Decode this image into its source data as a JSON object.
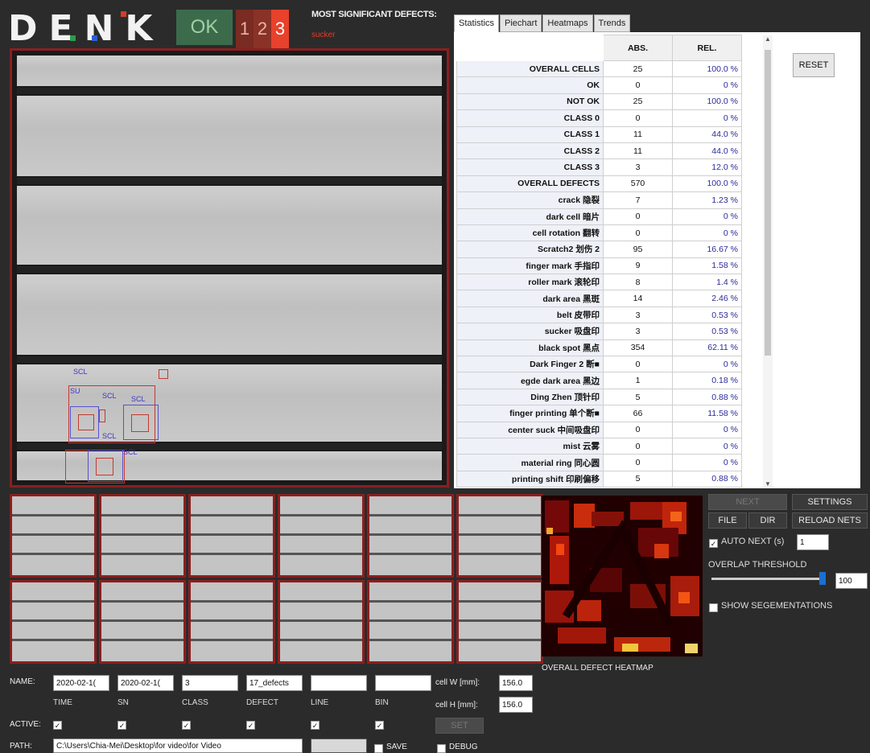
{
  "header": {
    "logo": "DENK",
    "ok_label": "OK",
    "class_buttons": [
      "1",
      "2",
      "3"
    ],
    "msd_title": "MOST SIGNIFICANT DEFECTS:",
    "msd_value": "sucker"
  },
  "main_image": {
    "labels": [
      "SCL",
      "SCL",
      "SU",
      "SCL",
      "SCL",
      "SCL",
      "SCL"
    ]
  },
  "tabs": [
    "Statistics",
    "Piechart",
    "Heatmaps",
    "Trends"
  ],
  "stats": {
    "col_abs": "ABS.",
    "col_rel": "REL.",
    "rows": [
      {
        "label": "OVERALL CELLS",
        "abs": "25",
        "rel": "100.0 %"
      },
      {
        "label": "OK",
        "abs": "0",
        "rel": "0 %"
      },
      {
        "label": "NOT OK",
        "abs": "25",
        "rel": "100.0 %"
      },
      {
        "label": "CLASS 0",
        "abs": "0",
        "rel": "0 %"
      },
      {
        "label": "CLASS 1",
        "abs": "11",
        "rel": "44.0 %"
      },
      {
        "label": "CLASS 2",
        "abs": "11",
        "rel": "44.0 %"
      },
      {
        "label": "CLASS 3",
        "abs": "3",
        "rel": "12.0 %"
      },
      {
        "label": "OVERALL DEFECTS",
        "abs": "570",
        "rel": "100.0 %"
      },
      {
        "label": "crack 隐裂",
        "abs": "7",
        "rel": "1.23 %"
      },
      {
        "label": "dark cell 暗片",
        "abs": "0",
        "rel": "0 %"
      },
      {
        "label": "cell rotation 翻转",
        "abs": "0",
        "rel": "0 %"
      },
      {
        "label": "Scratch2 划伤 2",
        "abs": "95",
        "rel": "16.67 %"
      },
      {
        "label": "finger mark 手指印",
        "abs": "9",
        "rel": "1.58 %"
      },
      {
        "label": "roller mark 滚轮印",
        "abs": "8",
        "rel": "1.4 %"
      },
      {
        "label": "dark area 黑斑",
        "abs": "14",
        "rel": "2.46 %"
      },
      {
        "label": "belt 皮带印",
        "abs": "3",
        "rel": "0.53 %"
      },
      {
        "label": "sucker 吸盘印",
        "abs": "3",
        "rel": "0.53 %"
      },
      {
        "label": "black spot 黑点",
        "abs": "354",
        "rel": "62.11 %"
      },
      {
        "label": "Dark Finger 2 断■",
        "abs": "0",
        "rel": "0 %"
      },
      {
        "label": "egde dark area 黑边",
        "abs": "1",
        "rel": "0.18 %"
      },
      {
        "label": "Ding Zhen 顶针印",
        "abs": "5",
        "rel": "0.88 %"
      },
      {
        "label": "finger printing 单个断■",
        "abs": "66",
        "rel": "11.58 %"
      },
      {
        "label": "center suck 中间吸盘印",
        "abs": "0",
        "rel": "0 %"
      },
      {
        "label": "mist 云雾",
        "abs": "0",
        "rel": "0 %"
      },
      {
        "label": "material ring 同心圆",
        "abs": "0",
        "rel": "0 %"
      },
      {
        "label": "printing shift 印刷偏移",
        "abs": "5",
        "rel": "0.88 %"
      }
    ]
  },
  "reset_label": "RESET",
  "controls": {
    "next": "NEXT",
    "settings": "SETTINGS",
    "file": "FILE",
    "dir": "DIR",
    "reload_nets": "RELOAD NETS",
    "auto_next_label": "AUTO NEXT (s)",
    "auto_next_value": "1",
    "overlap_label": "OVERLAP THRESHOLD",
    "overlap_value": "100",
    "overlap_level": 1.0,
    "show_seg_label": "SHOW SEGEMENTATIONS"
  },
  "heatmap_caption": "OVERALL DEFECT HEATMAP",
  "form": {
    "name_label": "NAME:",
    "fields": [
      "2020-02-1(",
      "2020-02-1(",
      "3",
      "17_defects",
      "",
      ""
    ],
    "columns": [
      "TIME",
      "SN",
      "CLASS",
      "DEFECT",
      "LINE",
      "BIN"
    ],
    "active_label": "ACTIVE:",
    "path_label": "PATH:",
    "path_value": "C:\\Users\\Chia-Mei\\Desktop\\for video\\for Video",
    "cell_w_label": "cell W [mm]:",
    "cell_w_value": "156.0",
    "cell_h_label": "cell H [mm]:",
    "cell_h_value": "156.0",
    "set_label": "SET",
    "save_label": "SAVE",
    "debug_label": "DEBUG",
    "check_mark": "✓"
  },
  "colors": {
    "accent_red": "#8b1f1f",
    "ok_green": "#3c6b4c",
    "class3_red": "#e8412c"
  }
}
